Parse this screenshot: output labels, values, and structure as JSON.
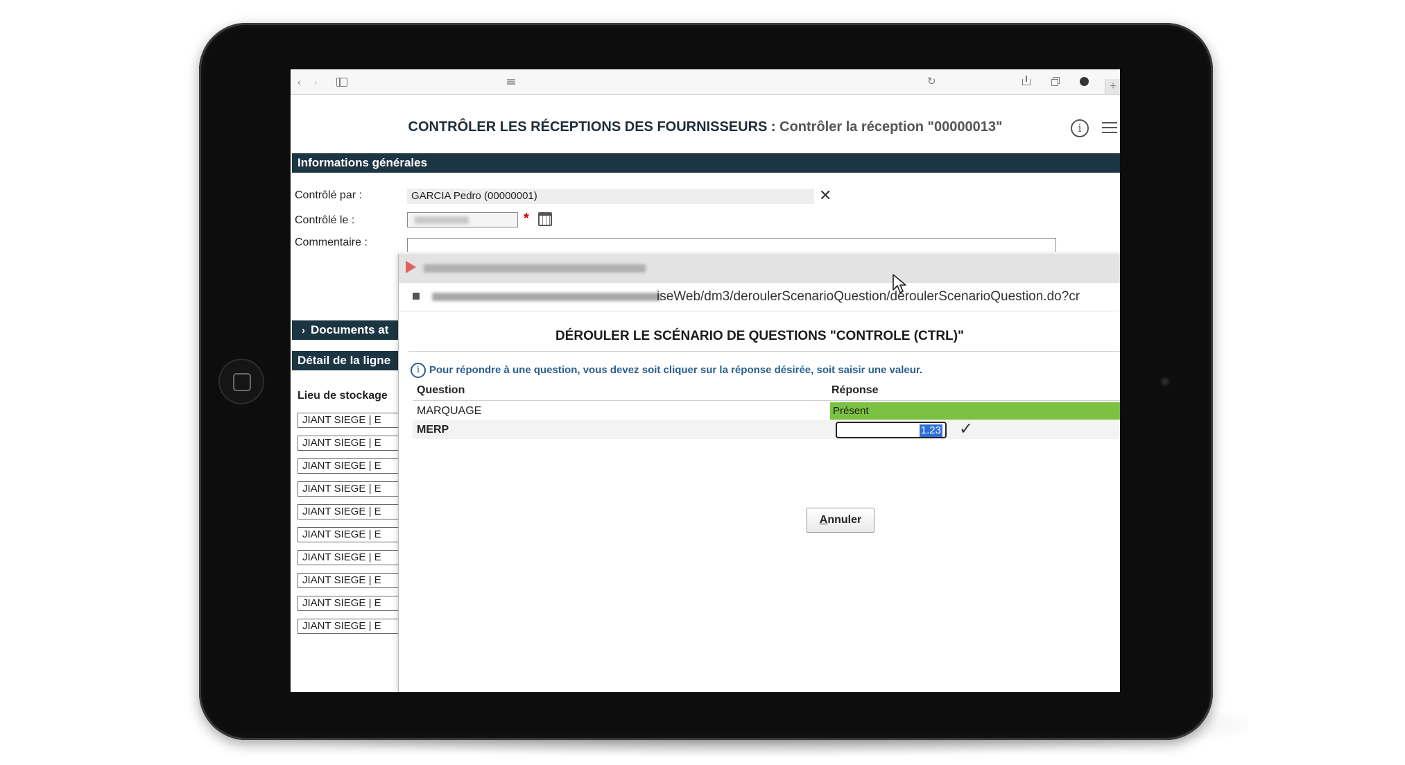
{
  "page": {
    "title": "CONTRÔLER LES RÉCEPTIONS DES FOURNISSEURS :",
    "subtitle": "Contrôler la réception \"00000013\""
  },
  "icons": {
    "info": "info-circle-icon",
    "menu": "hamburger-menu-icon",
    "close": "close-icon",
    "calendar": "calendar-icon",
    "check": "checkmark-icon",
    "chevron": "chevron-right-icon"
  },
  "general": {
    "header": "Informations générales",
    "controlled_by_label": "Contrôlé par :",
    "controlled_by_value": "GARCIA Pedro (00000001)",
    "controlled_on_label": "Contrôlé le :",
    "comment_label": "Commentaire :"
  },
  "documents": {
    "header": "Documents at"
  },
  "line_detail": {
    "header": "Détail de la ligne",
    "storage_header": "Lieu de stockage",
    "rows": [
      "JIANT SIEGE | E",
      "JIANT SIEGE | E",
      "JIANT SIEGE | E",
      "JIANT SIEGE | E",
      "JIANT SIEGE | E",
      "JIANT SIEGE | E",
      "JIANT SIEGE | E",
      "JIANT SIEGE | E",
      "JIANT SIEGE | E",
      "JIANT SIEGE | E"
    ]
  },
  "popup": {
    "url_visible": "iseWeb/dm3/deroulerScenarioQuestion/deroulerScenarioQuestion.do?cr",
    "title": "DÉROULER LE SCÉNARIO DE QUESTIONS \"CONTROLE (CTRL)\"",
    "info": "Pour répondre à une question, vous devez soit cliquer sur la réponse désirée, soit saisir une valeur.",
    "col_question": "Question",
    "col_response": "Réponse",
    "rows": [
      {
        "question": "MARQUAGE",
        "response": "Présent"
      },
      {
        "question": "MERP",
        "response": "1.23"
      }
    ],
    "cancel_rest": "nnuler",
    "cancel_accel": "A"
  },
  "colors": {
    "section_bar": "#1c3542",
    "present_green": "#7bc242",
    "info_blue": "#2a5e8c",
    "selection_blue": "#2f6ed8"
  }
}
